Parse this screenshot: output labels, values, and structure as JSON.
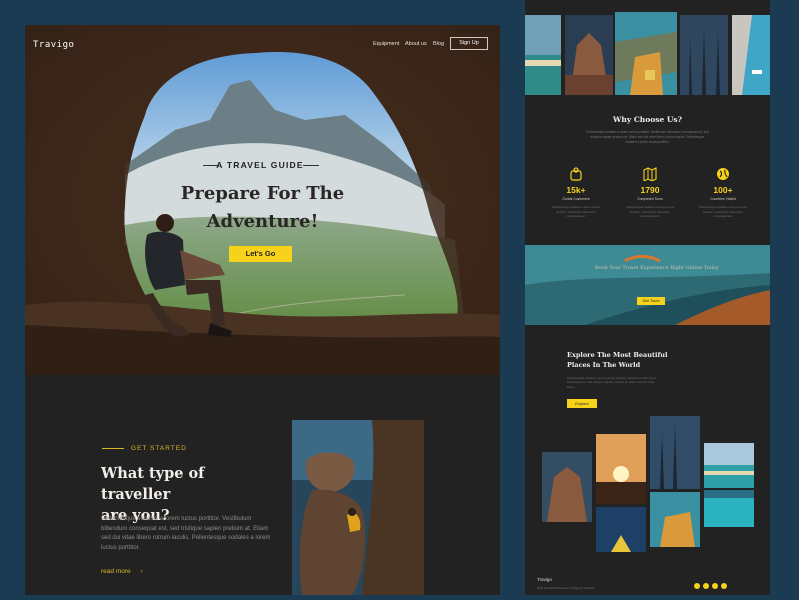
{
  "hero": {
    "logo": "Travigo",
    "nav": [
      "Equipment",
      "About us",
      "Blog"
    ],
    "signup": "Sign Up",
    "eyebrow": "A TRAVEL GUIDE",
    "title_line1": "Prepare For The",
    "title_line2": "Adventure!",
    "cta": "Let's Go"
  },
  "traveller": {
    "eyebrow": "GET STARTED",
    "title_line1": "What type of traveller",
    "title_line2": "are you?",
    "body": "Pellentesque sodales a lorem luctus porttitor. Vestibulum bibendum consequat est, sed tristique sapien pretium at. Etiam sed dui vitae libero rutrum iaculis. Pellentesque sodales a lorem luctus porttitor.",
    "read_more": "read more",
    "arrow": "›"
  },
  "why": {
    "title": "Why Choose Us?",
    "body": "Pellentesque sodales a lorem luctus porttitor. Vestibulum bibendum consequat est, sed tristique sapien pretium at. Etiam sed dui vitae libero rutrum iaculis. Pellentesque sodales a lorem luctus porttitor.",
    "stats": [
      {
        "icon": "traveller-icon",
        "value": "15k+",
        "label": "Global Customers",
        "desc": "Pellentesque sodales a lorem luctus porttitor. Vestibulum bibendum consequat est."
      },
      {
        "icon": "map-icon",
        "value": "1790",
        "label": "Completed Tours",
        "desc": "Pellentesque sodales a lorem luctus porttitor. Vestibulum bibendum consequat est."
      },
      {
        "icon": "globe-icon",
        "value": "100+",
        "label": "Countries Visited",
        "desc": "Pellentesque sodales a lorem luctus porttitor. Vestibulum bibendum consequat est."
      }
    ]
  },
  "banner": {
    "text": "Book Your Travel Experience Right Online Today",
    "button": "See Tours"
  },
  "explore": {
    "title_line1": "Explore The Most Beautiful",
    "title_line2": "Places In The World",
    "body": "Pellentesque sodales a lorem luctus porttitor. Vestibulum bibendum consequat est, sed tristique sapien pretium at. Etiam sed dui vitae libero.",
    "button": "Explore"
  },
  "footer": {
    "logo": "Travigo",
    "copyright": "2021 All Rights Reserved. Travigo by Webflow",
    "social": [
      "facebook-icon",
      "instagram-icon",
      "twitter-icon",
      "youtube-icon"
    ]
  },
  "colors": {
    "accent": "#f6d31a",
    "background": "#232223",
    "canvas": "#1b3b52"
  }
}
